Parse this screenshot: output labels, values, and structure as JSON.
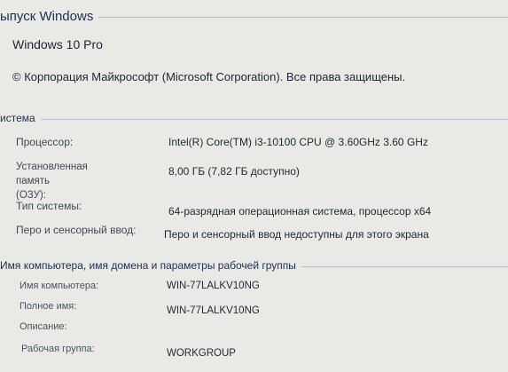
{
  "edition": {
    "section_title": "ыпуск Windows",
    "name": "Windows 10 Pro",
    "copyright": "© Корпорация Майкрософт (Microsoft Corporation). Все права защищены."
  },
  "system": {
    "section_title": "истема",
    "rows": [
      {
        "label": "Процессор:",
        "value": "Intel(R) Core(TM) i3-10100 CPU @ 3.60GHz   3.60 GHz"
      },
      {
        "label": "Установленная память\n(ОЗУ):",
        "value": "8,00 ГБ (7,82 ГБ доступно)"
      },
      {
        "label": "Тип системы:",
        "value": "64-разрядная операционная система, процессор x64"
      },
      {
        "label": "Перо и сенсорный ввод:",
        "value": "Перо и сенсорный ввод недоступны для этого экрана"
      }
    ]
  },
  "computer": {
    "section_title": "Имя компьютера, имя домена и параметры рабочей группы",
    "rows": [
      {
        "label": "Имя компьютера:",
        "value": "WIN-77LALKV10NG"
      },
      {
        "label": "Полное имя:",
        "value": "WIN-77LALKV10NG"
      },
      {
        "label": "Описание:",
        "value": ""
      },
      {
        "label": "Рабочая группа:",
        "value": "WORKGROUP"
      }
    ]
  }
}
